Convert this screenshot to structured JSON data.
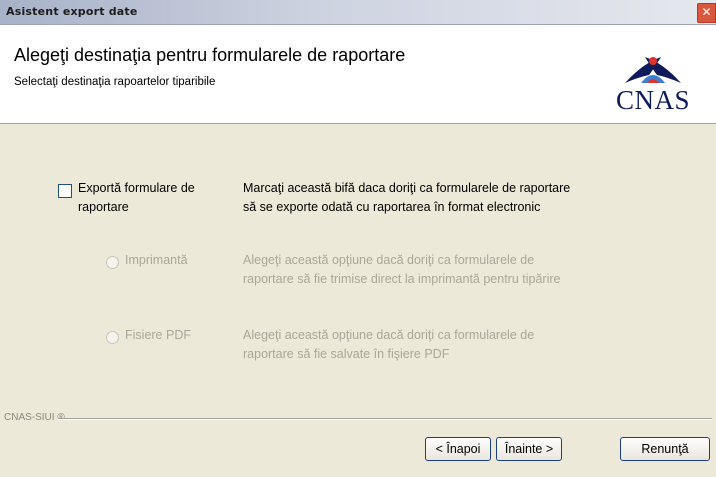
{
  "window": {
    "title": "Asistent export date",
    "close_glyph": "✕"
  },
  "header": {
    "title": "Alegeţi destinaţia pentru formularele de raportare",
    "subtitle": "Selectaţi destinaţia rapoartelor tiparibile",
    "logo_text": "CNAS",
    "logo_icon": "eagle-emblem-icon"
  },
  "options": {
    "export": {
      "label_line1": "Exportă formulare de",
      "label_line2": "raportare",
      "checked": false,
      "desc_line1": "Marcaţi această bifă daca doriţi ca formularele de raportare",
      "desc_line2": "să se exporte odată cu raportarea în format electronic"
    },
    "printer": {
      "label": "Imprimantă",
      "enabled": false,
      "desc_line1": "Alegeţi această opţiune dacă doriţi ca formularele de",
      "desc_line2": "raportare să fie trimise direct la imprimantă pentru tipărire"
    },
    "pdf": {
      "label": "Fisiere PDF",
      "enabled": false,
      "desc_line1": "Alegeţi această opţiune dacă doriţi ca formularele de",
      "desc_line2": "raportare să fie salvate în fişiere PDF"
    }
  },
  "footer": {
    "tag": "CNAS-SIUI ®",
    "back_label": "< Înapoi",
    "next_label": "Înainte >",
    "cancel_label": "Renunţă"
  },
  "colors": {
    "logo_navy": "#0e1a5a",
    "button_border": "#1c3f88",
    "disabled_text": "#a9a79a"
  }
}
